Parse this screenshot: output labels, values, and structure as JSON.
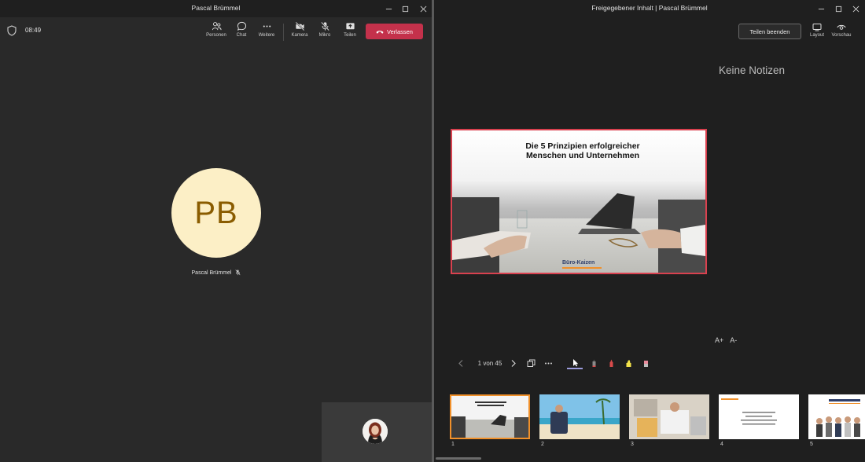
{
  "left_window": {
    "title": "Pascal Brümmel",
    "timer": "08:49",
    "toolbar": [
      {
        "label": "Personen",
        "icon": "people-icon"
      },
      {
        "label": "Chat",
        "icon": "chat-icon"
      },
      {
        "label": "Weitere",
        "icon": "more-icon"
      },
      {
        "label": "Kamera",
        "icon": "camera-off-icon"
      },
      {
        "label": "Mikro",
        "icon": "mic-off-icon"
      },
      {
        "label": "Teilen",
        "icon": "share-icon"
      }
    ],
    "leave_label": "Verlassen",
    "participant": {
      "initials": "PB",
      "name": "Pascal Brümmel"
    }
  },
  "right_window": {
    "title": "Freigegebener Inhalt | Pascal Brümmel",
    "stop_sharing_label": "Teilen beenden",
    "toolbar": [
      {
        "label": "Layout",
        "icon": "layout-icon"
      },
      {
        "label": "Vorschau",
        "icon": "preview-eye-icon"
      }
    ],
    "notes": "Keine Notizen",
    "slide": {
      "title_line1": "Die 5 Prinzipien erfolgreicher",
      "title_line2": "Menschen und Unternehmen",
      "logo": "Büro-Kaizen"
    },
    "font_size": {
      "increase": "A+",
      "decrease": "A-"
    },
    "pager": "1 von 45",
    "thumbnails": [
      {
        "number": "1",
        "active": true
      },
      {
        "number": "2",
        "active": false
      },
      {
        "number": "3",
        "active": false
      },
      {
        "number": "4",
        "active": false
      },
      {
        "number": "5",
        "active": false
      }
    ]
  },
  "colors": {
    "leave_button": "#c4314b",
    "avatar_bg": "#fcefc6",
    "avatar_text": "#8a5c00",
    "slide_border": "#d9414f",
    "thumb_active": "#f0902a"
  }
}
